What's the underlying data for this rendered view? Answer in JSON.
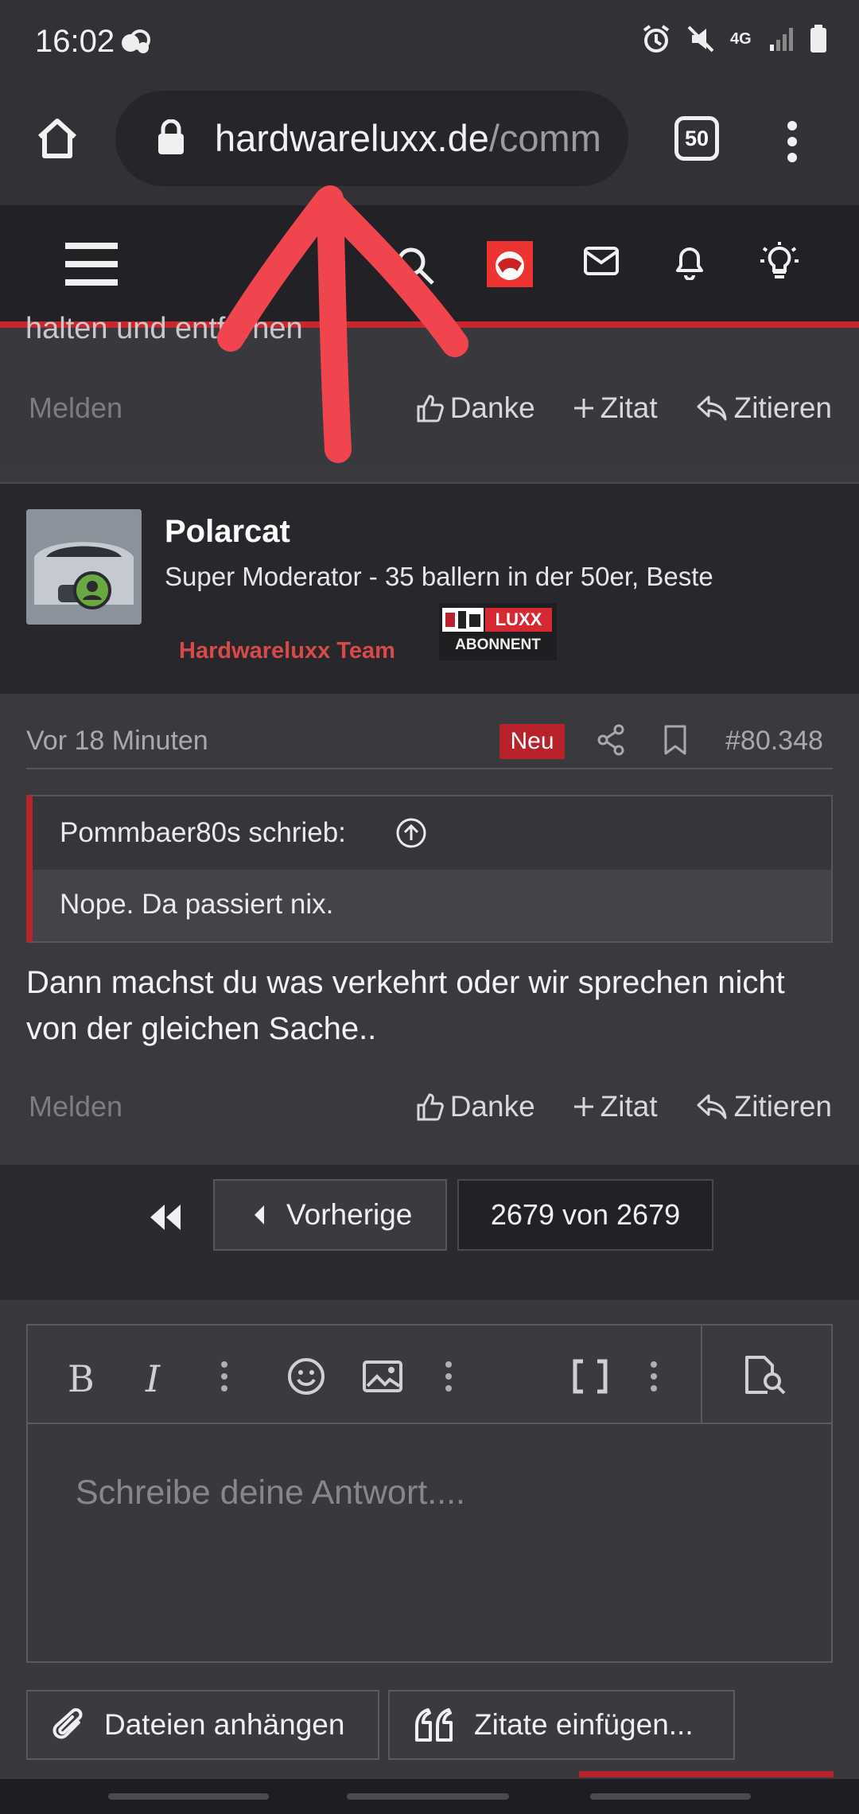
{
  "status_bar": {
    "time": "16:02",
    "network": "4G"
  },
  "browser": {
    "url_main": "hardwareluxx.de",
    "url_rest": "/comm",
    "tab_count": "50"
  },
  "post_fragment": {
    "text": "halten und entfernen",
    "report": "Melden",
    "thanks": "Danke",
    "quote_plus": "Zitat",
    "reply_quote": "Zitieren"
  },
  "author": {
    "name": "Polarcat",
    "title": "Super Moderator - 35 ballern in der 50er, Beste",
    "team": "Hardwareluxx Team",
    "badge_top": "LUXX",
    "badge_bottom": "ABONNENT"
  },
  "post_meta": {
    "time": "Vor 18 Minuten",
    "new_label": "Neu",
    "number": "#80.348"
  },
  "quote": {
    "author": "Pommbaer80s schrieb:",
    "text": "Nope. Da passiert nix."
  },
  "post_body": "Dann machst du was verkehrt oder wir sprechen nicht von der gleichen Sache..",
  "post_actions": {
    "report": "Melden",
    "thanks": "Danke",
    "quote_plus": "Zitat",
    "reply_quote": "Zitieren"
  },
  "pagination": {
    "prev": "Vorherige",
    "status": "2679 von 2679"
  },
  "editor": {
    "placeholder": "Schreibe deine Antwort...."
  },
  "footer": {
    "attach": "Dateien anhängen",
    "insert_quotes": "Zitate einfügen..."
  },
  "colors": {
    "accent_red": "#b8232b",
    "arrow_red": "#f0454f",
    "online_green": "#6aa842"
  }
}
